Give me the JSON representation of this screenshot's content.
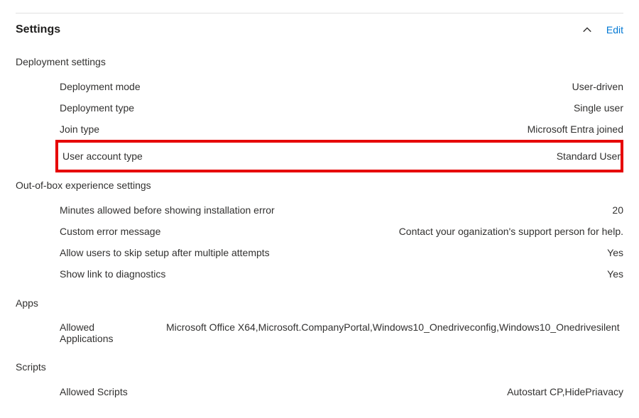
{
  "header": {
    "title": "Settings",
    "edit_label": "Edit"
  },
  "sections": {
    "deployment": {
      "title": "Deployment settings",
      "rows": {
        "mode": {
          "label": "Deployment mode",
          "value": "User-driven"
        },
        "type": {
          "label": "Deployment type",
          "value": "Single user"
        },
        "join": {
          "label": "Join type",
          "value": "Microsoft Entra joined"
        },
        "account": {
          "label": "User account type",
          "value": "Standard User"
        }
      }
    },
    "oobe": {
      "title": "Out-of-box experience settings",
      "rows": {
        "minutes": {
          "label": "Minutes allowed before showing installation error",
          "value": "20"
        },
        "custom_err": {
          "label": "Custom error message",
          "value": "Contact your oganization's support person for help."
        },
        "skip": {
          "label": "Allow users to skip setup after multiple attempts",
          "value": "Yes"
        },
        "diag": {
          "label": "Show link to diagnostics",
          "value": "Yes"
        }
      }
    },
    "apps": {
      "title": "Apps",
      "row": {
        "label": "Allowed Applications",
        "value": "Microsoft Office X64,Microsoft.CompanyPortal,Windows10_Onedriveconfig,Windows10_Onedrivesilent"
      }
    },
    "scripts": {
      "title": "Scripts",
      "row": {
        "label": "Allowed Scripts",
        "value": "Autostart CP,HidePriavacy"
      }
    }
  }
}
